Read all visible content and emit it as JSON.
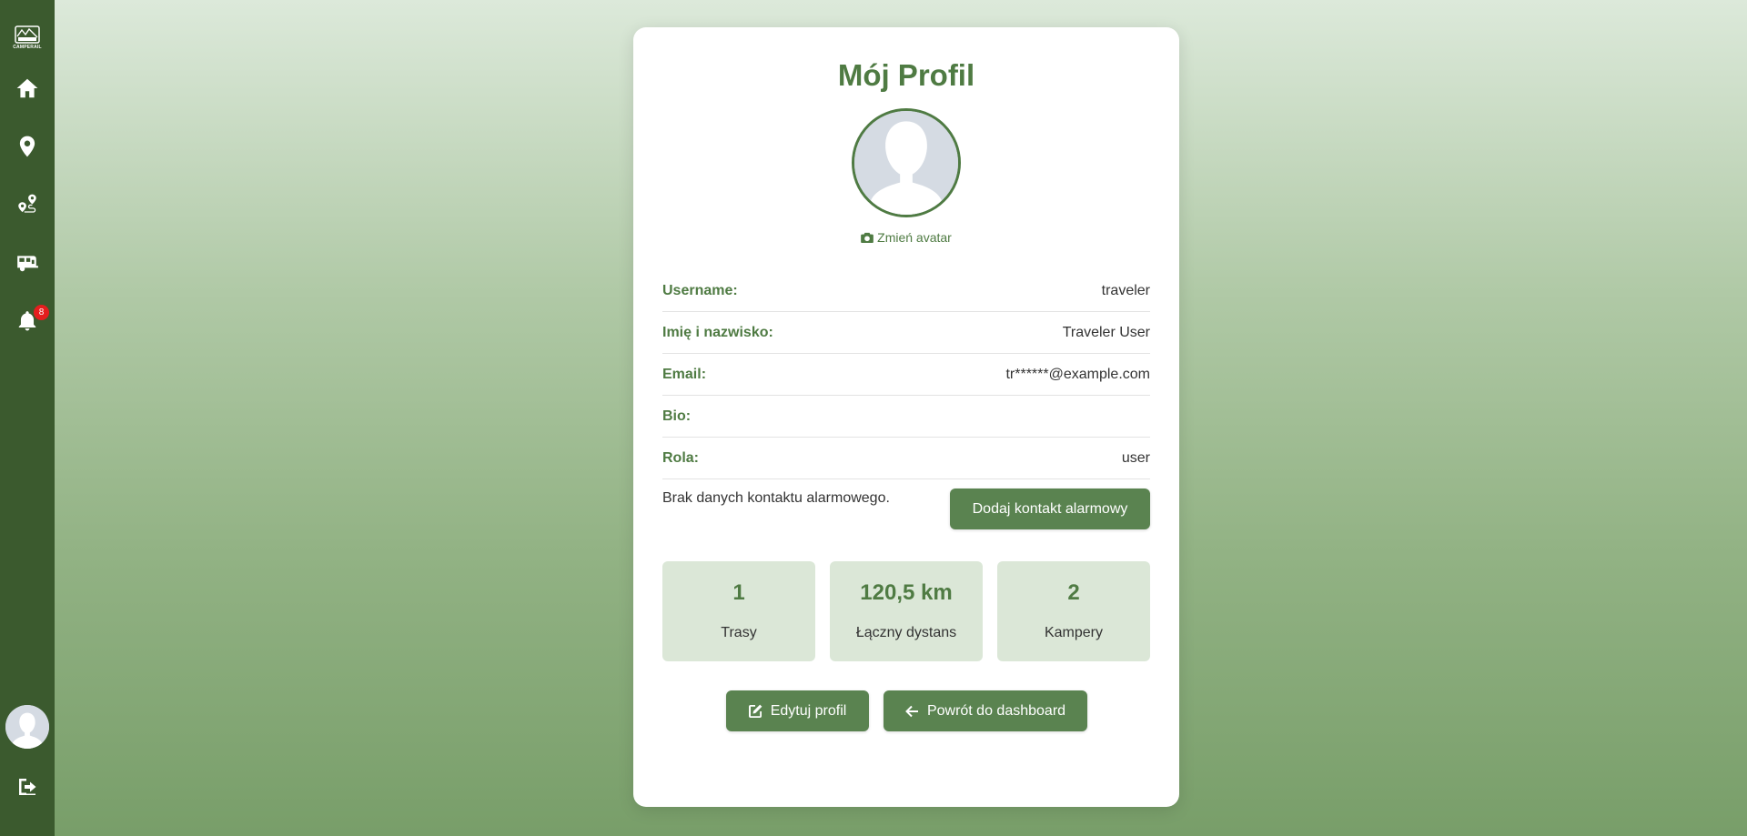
{
  "sidebar": {
    "logo_text": "CAMPERAIL",
    "items": [
      {
        "icon": "home-icon"
      },
      {
        "icon": "map-marker-icon"
      },
      {
        "icon": "route-icon"
      },
      {
        "icon": "camper-van-icon"
      },
      {
        "icon": "bell-icon",
        "badge": "8"
      }
    ],
    "avatar_icon": "user-avatar-icon",
    "logout_icon": "logout-icon"
  },
  "profile": {
    "title": "Mój Profil",
    "change_avatar": "Zmień avatar",
    "fields": [
      {
        "label": "Username:",
        "value": "traveler"
      },
      {
        "label": "Imię i nazwisko:",
        "value": "Traveler User"
      },
      {
        "label": "Email:",
        "value": "tr******@example.com"
      },
      {
        "label": "Bio:",
        "value": ""
      },
      {
        "label": "Rola:",
        "value": "user"
      }
    ],
    "emergency_text": "Brak danych kontaktu alarmowego.",
    "add_emergency_button": "Dodaj kontakt alarmowy",
    "stats": [
      {
        "value": "1",
        "label": "Trasy"
      },
      {
        "value": "120,5 km",
        "label": "Łączny dystans"
      },
      {
        "value": "2",
        "label": "Kampery"
      }
    ],
    "edit_button": "Edytuj profil",
    "back_button": "Powrót do dashboard"
  },
  "colors": {
    "sidebar": "#3b5a2e",
    "accent": "#4f7b43",
    "button": "#5a8350",
    "stat_bg": "#dbe7d7",
    "badge": "#e41e1e"
  }
}
